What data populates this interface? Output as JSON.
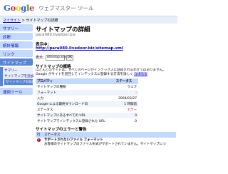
{
  "header": {
    "product": "ウェブマスター ツール"
  },
  "breadcrumb": {
    "home": "マイサイト",
    "separator": " > ",
    "current": "サイトマップの詳細"
  },
  "sidebar": {
    "items": [
      {
        "label": "サマリー"
      },
      {
        "label": "診断"
      },
      {
        "label": "統計情報"
      },
      {
        "label": "リンク"
      },
      {
        "label": "サイトマップ"
      }
    ],
    "subitems": [
      {
        "label": "サマリー"
      },
      {
        "label": "サイトマップを追加"
      },
      {
        "label": "サイトマップの詳細"
      }
    ],
    "tools": "運用ツール"
  },
  "main": {
    "title": "サイトマップの詳細",
    "site": "para080.livedoor.biz",
    "view_label": "表示中:",
    "sitemap_url": "http://para080.livedoor.biz/sitemap.xml",
    "filter_label": "表示:",
    "filter_value": "sitemap.xml",
    "ok_label": "OK",
    "overview_title": "サイトマップの概略",
    "overview_desc": "ほとんどのサイトは、すべてのページがインデックスに登録されるわけではありません。Google がサイトを巡回してインデックスに登録する方法を詳しく",
    "overview_link": "詳細情報",
    "table_head_prop": "プロパティ",
    "table_head_status": "ステータス",
    "rows": [
      {
        "k": "サイトマップの種類",
        "v": "ウェブ"
      },
      {
        "k": "フォーマット",
        "v": "-"
      },
      {
        "k": "入力",
        "v": "2008/03/27"
      },
      {
        "k": "Google による最終ダウンロード日",
        "v": "1 時間前"
      },
      {
        "k": "ステータス",
        "v": "エラー"
      },
      {
        "k": "サイトマップにあるすべての URL",
        "v": "0"
      },
      {
        "k": "サイトマップでインデックスに登録された URL",
        "v": "0"
      }
    ],
    "errors_title": "サイトマップのエラーと警告",
    "err_head_line": "行",
    "err_head_status": "ステータス",
    "err_main": "サポートされないファイル フォーマット",
    "err_desc": "お客様のサイトマップのファイル形式がサポートされていません。サイトマップにつ"
  }
}
